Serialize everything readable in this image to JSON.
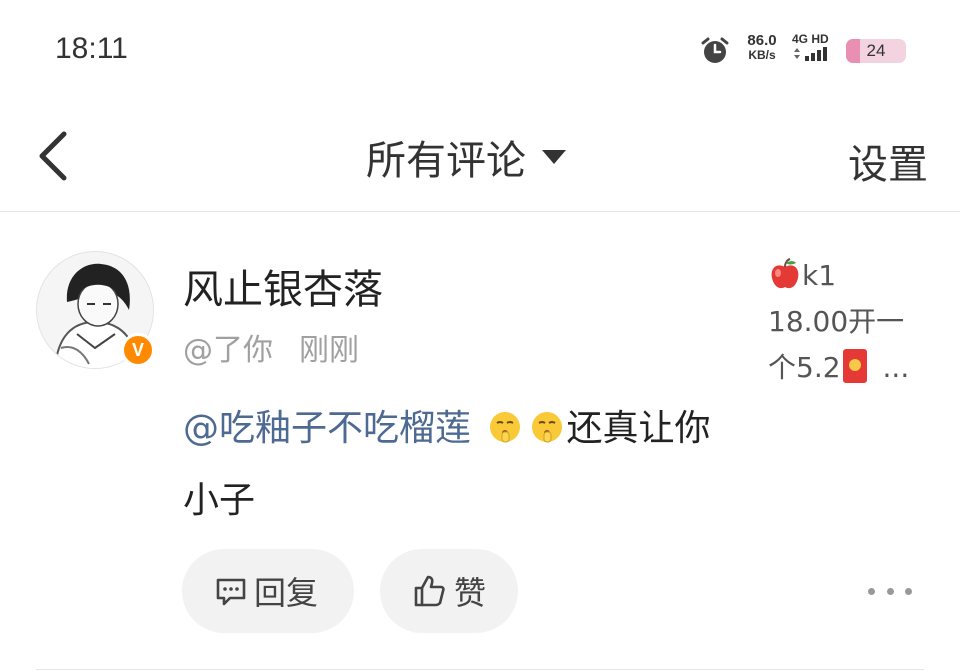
{
  "status_bar": {
    "time": "18:11",
    "speed_value": "86.0",
    "speed_unit": "KB/s",
    "network_label": "4G HD",
    "battery": "24",
    "battery_level": 0.24,
    "icons": [
      "alarm-icon",
      "signal-icon"
    ]
  },
  "header": {
    "title": "所有评论",
    "settings_label": "设置",
    "icons": [
      "back-icon",
      "dropdown-caret-icon"
    ]
  },
  "comment": {
    "username": "风止银杏落",
    "handle": "@了你",
    "time": "刚刚",
    "badge": "V",
    "badge_color": "#ff8a00",
    "signature": {
      "line1": "k1",
      "line2": "18.00开一",
      "line3": "个5.2",
      "more": "..."
    },
    "mention": "@吃釉子不吃榴莲",
    "text": "还真让你小子",
    "mention_color": "#4e6a93",
    "reply_label": "回复",
    "like_label": "赞"
  }
}
